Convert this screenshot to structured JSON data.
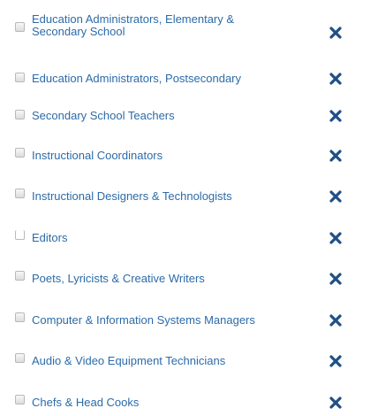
{
  "items": [
    {
      "label": "Education Administrators, Elementary & Secondary School",
      "checked": false,
      "remove_icon": "close-x-icon"
    },
    {
      "label": "Education Administrators, Postsecondary",
      "checked": false,
      "remove_icon": "close-x-icon"
    },
    {
      "label": "Secondary School Teachers",
      "checked": false,
      "remove_icon": "close-x-icon"
    },
    {
      "label": "Instructional Coordinators",
      "checked": false,
      "remove_icon": "close-x-icon"
    },
    {
      "label": "Instructional Designers & Technologists",
      "checked": false,
      "remove_icon": "close-x-icon"
    },
    {
      "label": "Editors",
      "checked": false,
      "remove_icon": "close-x-icon"
    },
    {
      "label": "Poets, Lyricists & Creative Writers",
      "checked": false,
      "remove_icon": "close-x-icon"
    },
    {
      "label": "Computer & Information Systems Managers",
      "checked": false,
      "remove_icon": "close-x-icon"
    },
    {
      "label": "Audio & Video Equipment Technicians",
      "checked": false,
      "remove_icon": "close-x-icon"
    },
    {
      "label": "Chefs & Head Cooks",
      "checked": false,
      "remove_icon": "close-x-icon"
    }
  ],
  "colors": {
    "label": "#2c6ba8",
    "remove_icon": "#1f4f86",
    "checkbox_border": "#b9b9b9"
  }
}
